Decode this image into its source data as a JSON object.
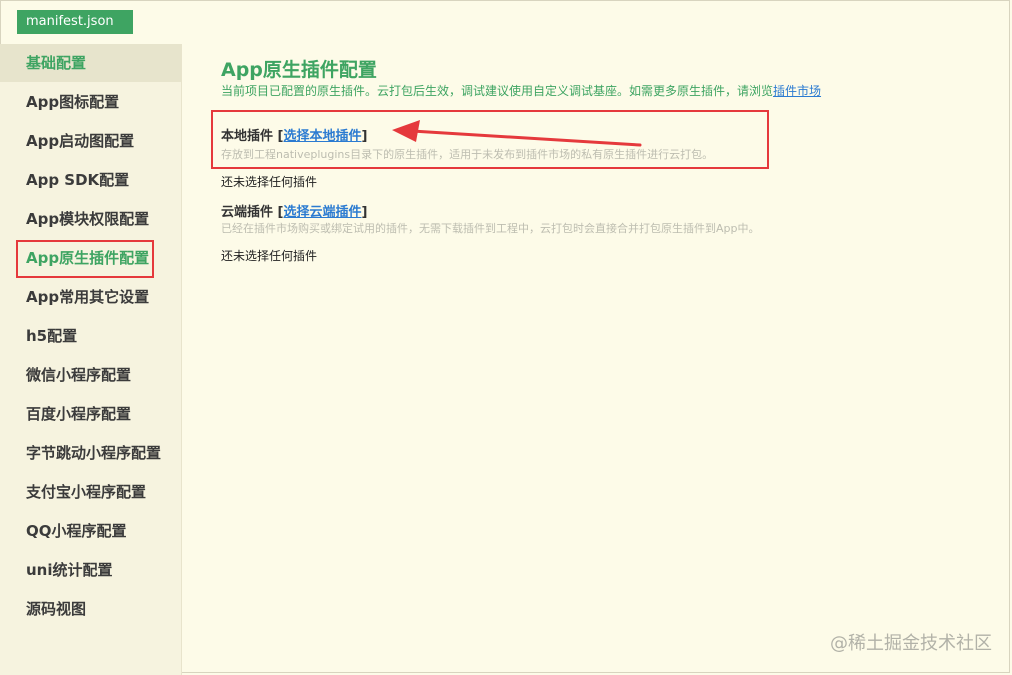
{
  "tab": {
    "label": "manifest.json"
  },
  "sidebar": {
    "items": [
      {
        "label": "基础配置"
      },
      {
        "label": "App图标配置"
      },
      {
        "label": "App启动图配置"
      },
      {
        "label": "App SDK配置"
      },
      {
        "label": "App模块权限配置"
      },
      {
        "label": "App原生插件配置"
      },
      {
        "label": "App常用其它设置"
      },
      {
        "label": "h5配置"
      },
      {
        "label": "微信小程序配置"
      },
      {
        "label": "百度小程序配置"
      },
      {
        "label": "字节跳动小程序配置"
      },
      {
        "label": "支付宝小程序配置"
      },
      {
        "label": "QQ小程序配置"
      },
      {
        "label": "uni统计配置"
      },
      {
        "label": "源码视图"
      }
    ]
  },
  "main": {
    "title": "App原生插件配置",
    "description": "当前项目已配置的原生插件。云打包后生效，调试建议使用自定义调试基座。如需更多原生插件，请浏览",
    "market_link": "插件市场",
    "local": {
      "title": "本地插件",
      "bracket_open": "[",
      "bracket_close": "]",
      "link": "选择本地插件",
      "note": "存放到工程nativeplugins目录下的原生插件，适用于未发布到插件市场的私有原生插件进行云打包。",
      "empty": "还未选择任何插件"
    },
    "cloud": {
      "title": "云端插件",
      "bracket_open": "[",
      "bracket_close": "]",
      "link": "选择云端插件",
      "note": "已经在插件市场购买或绑定试用的插件，无需下载插件到工程中，云打包时会直接合并打包原生插件到App中。",
      "empty": "还未选择任何插件"
    }
  },
  "watermark": "@稀土掘金技术社区",
  "colors": {
    "accent": "#3ea462",
    "link": "#2b7bd1",
    "highlight": "#e5393c",
    "background": "#fdfbe8"
  }
}
